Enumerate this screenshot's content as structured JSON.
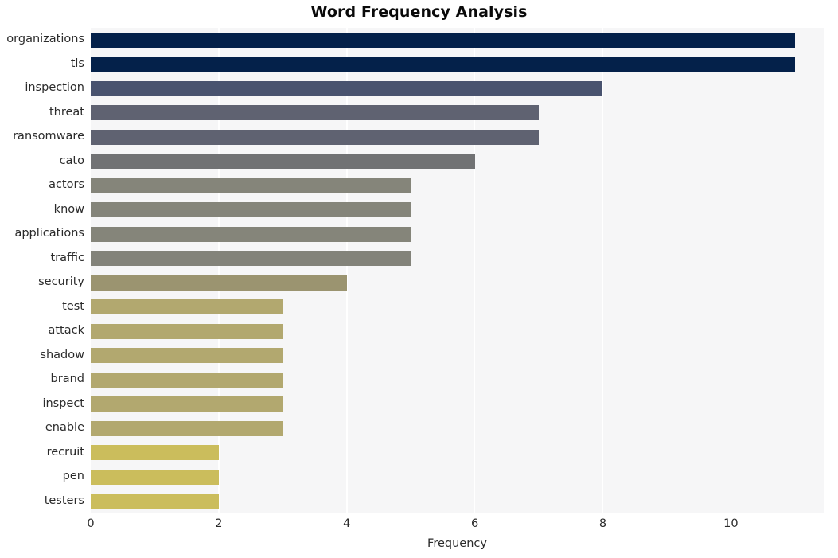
{
  "chart_data": {
    "type": "bar",
    "orientation": "horizontal",
    "title": "Word Frequency Analysis",
    "xlabel": "Frequency",
    "ylabel": "",
    "xlim": [
      0,
      11.45
    ],
    "ylim": null,
    "grid": true,
    "legend": null,
    "x_ticks": [
      0,
      2,
      4,
      6,
      8,
      10
    ],
    "x_tick_labels": [
      "0",
      "2",
      "4",
      "6",
      "8",
      "10"
    ],
    "categories": [
      "organizations",
      "tls",
      "inspection",
      "threat",
      "ransomware",
      "cato",
      "actors",
      "know",
      "applications",
      "traffic",
      "security",
      "test",
      "attack",
      "shadow",
      "brand",
      "inspect",
      "enable",
      "recruit",
      "pen",
      "testers"
    ],
    "values": [
      11,
      11,
      8,
      7,
      7,
      6,
      5,
      5,
      5,
      5,
      4,
      3,
      3,
      3,
      3,
      3,
      3,
      2,
      2,
      2
    ],
    "bar_colors": [
      "#04214a",
      "#04214a",
      "#49536f",
      "#5f6271",
      "#5f6271",
      "#717274",
      "#85857a",
      "#85857a",
      "#85857a",
      "#83837a",
      "#9b9470",
      "#b2a86f",
      "#b2a86f",
      "#b2a86f",
      "#b2a86f",
      "#b2a86f",
      "#b2a86f",
      "#cbbd5c",
      "#cbbd5c",
      "#cbbd5c"
    ],
    "plot_background": "#f6f6f7",
    "gridline_color": "#ffffff",
    "figure_background": "#ffffff",
    "text_color": "#2b2b2b"
  }
}
